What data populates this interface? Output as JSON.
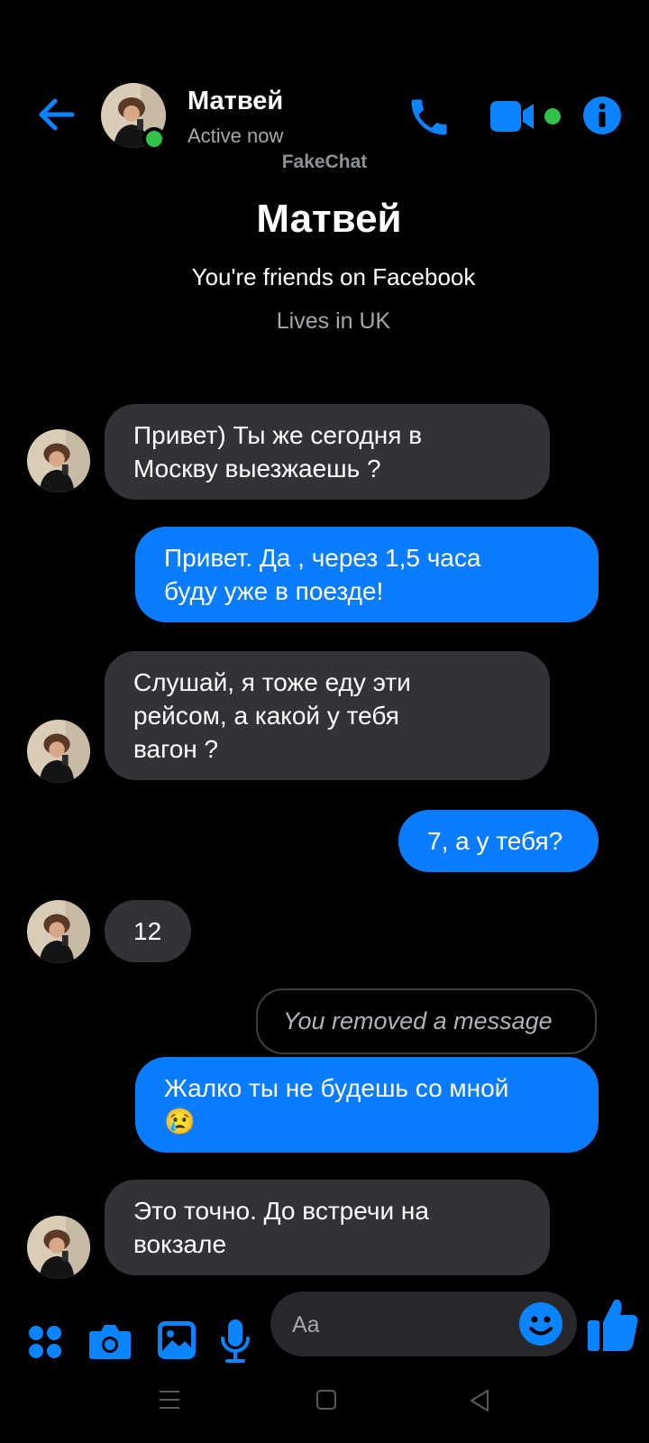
{
  "header": {
    "contact_name": "Матвей",
    "status": "Active now",
    "watermark": "FakeChat",
    "icons": [
      "back-arrow-icon",
      "phone-icon",
      "video-camera-icon",
      "info-icon"
    ]
  },
  "profile": {
    "name": "Матвей",
    "friends_note": "You're friends on Facebook",
    "location": "Lives in UK"
  },
  "messages": [
    {
      "from": "contact",
      "lines": [
        "Привет) Ты же сегодня в",
        "Москву выезжаешь ?"
      ]
    },
    {
      "from": "me",
      "lines": [
        "Привет. Да , через 1,5 часа",
        "буду уже в поезде!"
      ]
    },
    {
      "from": "contact",
      "lines": [
        "Слушай, я тоже еду эти",
        "рейсом, а какой у тебя",
        "вагон ?"
      ]
    },
    {
      "from": "me",
      "lines": [
        "7, а у тебя?"
      ]
    },
    {
      "from": "contact",
      "lines": [
        "12"
      ]
    },
    {
      "from": "me",
      "removed": true,
      "lines": [
        "You removed a message"
      ]
    },
    {
      "from": "me",
      "lines": [
        "Жалко ты не будешь со мной",
        "😢"
      ]
    },
    {
      "from": "contact",
      "lines": [
        "Это точно. До встречи на",
        "вокзале"
      ]
    }
  ],
  "composer": {
    "placeholder": "Aa",
    "icons": [
      "apps-icon",
      "camera-icon",
      "gallery-icon",
      "microphone-icon",
      "emoji-icon",
      "thumbs-up-icon"
    ]
  },
  "colors": {
    "accent": "#0a84ff",
    "outgoing_bubble": "#0a7cff",
    "incoming_bubble": "#333236",
    "online": "#31c24a",
    "background": "#000000"
  }
}
